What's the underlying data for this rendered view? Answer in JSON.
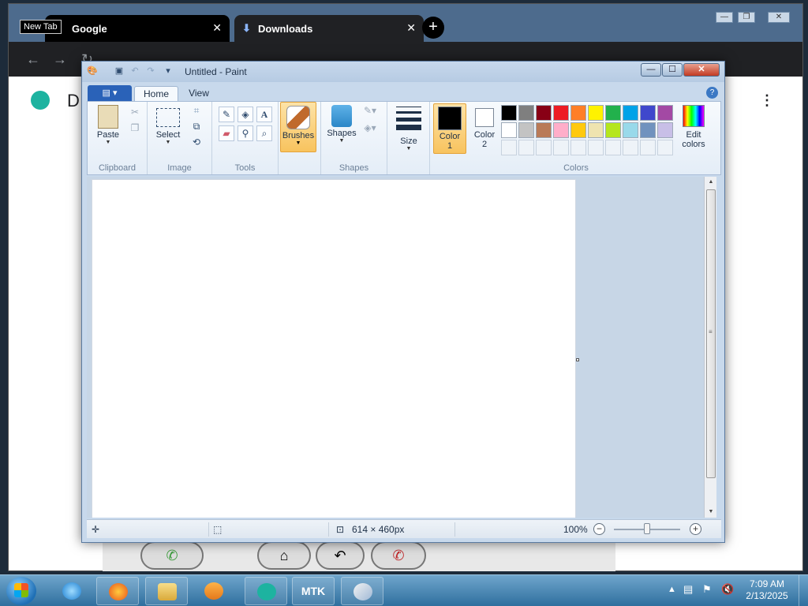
{
  "chrome": {
    "tooltip": "New Tab",
    "tabs": [
      {
        "label": "Google"
      },
      {
        "label": "Downloads"
      }
    ],
    "close_glyph": "✕",
    "new_tab_glyph": "+",
    "page_heading_initial": "D",
    "icons": [
      "google-favicon",
      "download-icon",
      "back-icon",
      "forward-icon",
      "reload-icon",
      "profile-icon",
      "menu-icon",
      "edge-logo-icon"
    ]
  },
  "phone_bar": {
    "icons": [
      "call-icon",
      "home-icon",
      "back-icon",
      "hangup-icon"
    ]
  },
  "paint": {
    "title": "Untitled - Paint",
    "tabs": {
      "home": "Home",
      "view": "View"
    },
    "groups": {
      "clipboard": {
        "label": "Clipboard",
        "paste": "Paste"
      },
      "image": {
        "label": "Image",
        "select": "Select"
      },
      "tools": {
        "label": "Tools"
      },
      "brushes": {
        "label": "Brushes"
      },
      "shapes": {
        "label": "Shapes",
        "button": "Shapes"
      },
      "size": {
        "label": "Size"
      },
      "colors": {
        "label": "Colors",
        "color1_line1": "Color",
        "color1_line2": "1",
        "color2_line1": "Color",
        "color2_line2": "2",
        "edit_line1": "Edit",
        "edit_line2": "colors",
        "color1_value": "#000000",
        "color2_value": "#ffffff"
      }
    },
    "palette_row1": [
      "#000000",
      "#7f7f7f",
      "#880015",
      "#ed1c24",
      "#ff7f27",
      "#fff200",
      "#22b14c",
      "#00a2e8",
      "#3f48cc",
      "#a349a4"
    ],
    "palette_row2": [
      "#ffffff",
      "#c3c3c3",
      "#b97a57",
      "#ffaec9",
      "#ffc90e",
      "#efe4b0",
      "#b5e61d",
      "#99d9ea",
      "#7092be",
      "#c8bfe7"
    ],
    "status": {
      "canvas_size": "614 × 460px",
      "zoom": "100%"
    }
  },
  "taskbar": {
    "mtk_label": "MTK",
    "time": "7:09 AM",
    "date": "2/13/2025",
    "icons": [
      "start-icon",
      "ie-icon",
      "firefox-icon",
      "explorer-icon",
      "media-player-icon",
      "edge-app-icon",
      "paint-app-icon",
      "tray-arrow-icon",
      "network-icon",
      "flag-icon",
      "volume-muted-icon"
    ]
  }
}
